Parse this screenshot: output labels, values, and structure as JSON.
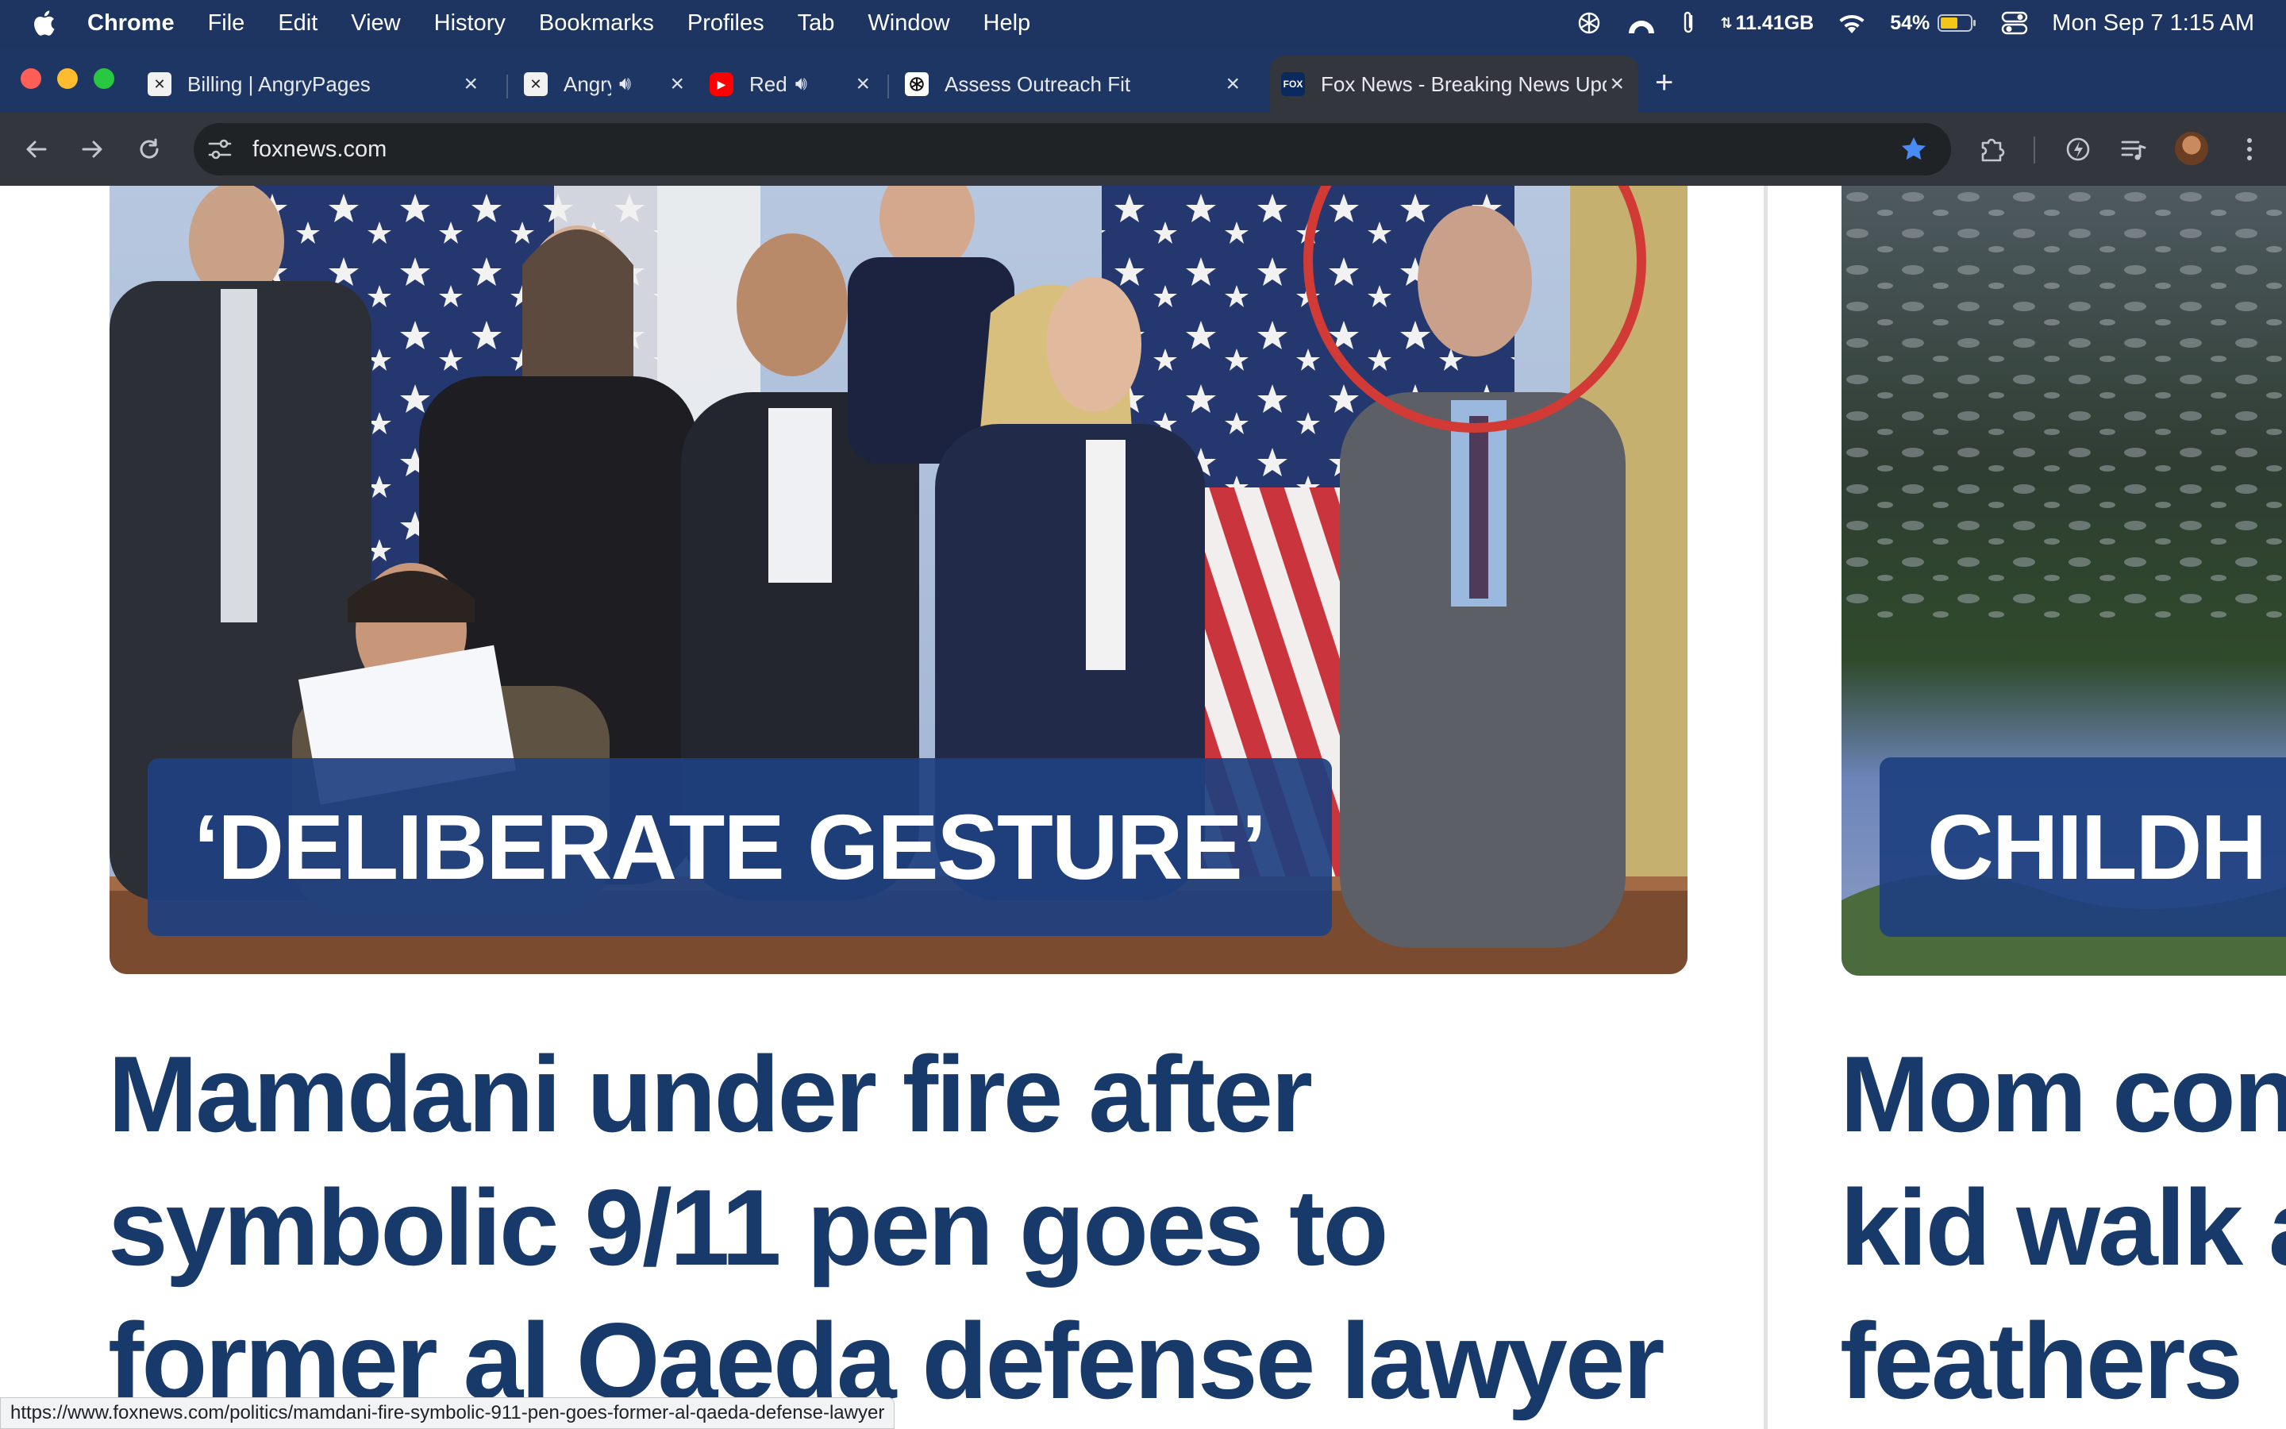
{
  "menubar": {
    "app_name": "Chrome",
    "items": [
      "File",
      "Edit",
      "View",
      "History",
      "Bookmarks",
      "Profiles",
      "Tab",
      "Window",
      "Help"
    ],
    "memory": "11.41GB",
    "battery_percent": "54%",
    "datetime": "Mon Sep 7  1:15 AM"
  },
  "tabs": [
    {
      "title": "Billing | AngryPages",
      "favicon": "angrypages-icon",
      "active": false
    },
    {
      "title": "Angry",
      "favicon": "angrypages-icon",
      "audio": true,
      "active": false
    },
    {
      "title": "Red",
      "favicon": "youtube-icon",
      "audio": true,
      "active": false
    },
    {
      "title": "Assess Outreach Fit",
      "favicon": "openai-icon",
      "active": false
    },
    {
      "title": "Fox News - Breaking News Updates",
      "favicon": "foxnews-icon",
      "active": true
    }
  ],
  "toolbar": {
    "url": "foxnews.com",
    "bookmarked": true
  },
  "stories": [
    {
      "kicker": "‘DELIBERATE GESTURE’",
      "headline_lines": [
        "Mamdani under fire after",
        "symbolic 9/11 pen goes to",
        "former al Qaeda defense lawyer"
      ]
    },
    {
      "kicker": "CHILDH",
      "headline_lines": [
        "Mom con",
        "kid walk a",
        "feathers"
      ]
    }
  ],
  "status_bar": {
    "hover_url": "https://www.foxnews.com/politics/mamdani-fire-symbolic-911-pen-goes-former-al-qaeda-defense-lawyer"
  },
  "colors": {
    "menubar_bg": "#1d3560",
    "tabstrip_bg": "#1e3663",
    "toolbar_bg": "#33373d",
    "headline": "#183a6b",
    "kicker_bg": "#1e4080",
    "star": "#4a8af4"
  }
}
